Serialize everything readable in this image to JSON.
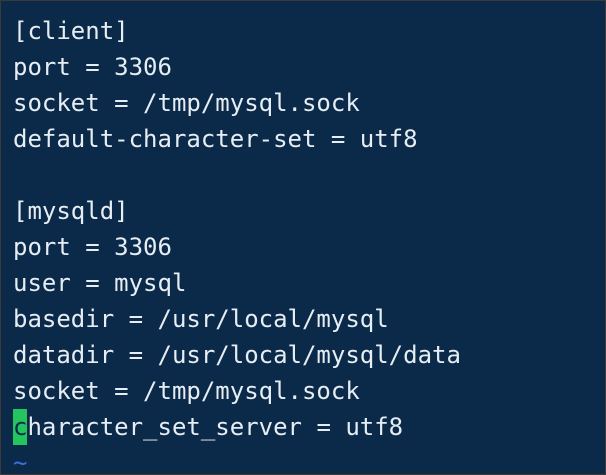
{
  "editor": {
    "lines": [
      "[client]",
      "port = 3306",
      "socket = /tmp/mysql.sock",
      "default-character-set = utf8",
      "",
      "[mysqld]",
      "port = 3306",
      "user = mysql",
      "basedir = /usr/local/mysql",
      "datadir = /usr/local/mysql/data",
      "socket = /tmp/mysql.sock"
    ],
    "cursor_line": {
      "cursor_char": "c",
      "rest": "haracter_set_server = utf8"
    },
    "empty_line_marker": "~"
  },
  "colors": {
    "background": "#0b2a4a",
    "text": "#e6edf3",
    "cursor": "#22c55e",
    "tilde": "#3b6fd6"
  }
}
